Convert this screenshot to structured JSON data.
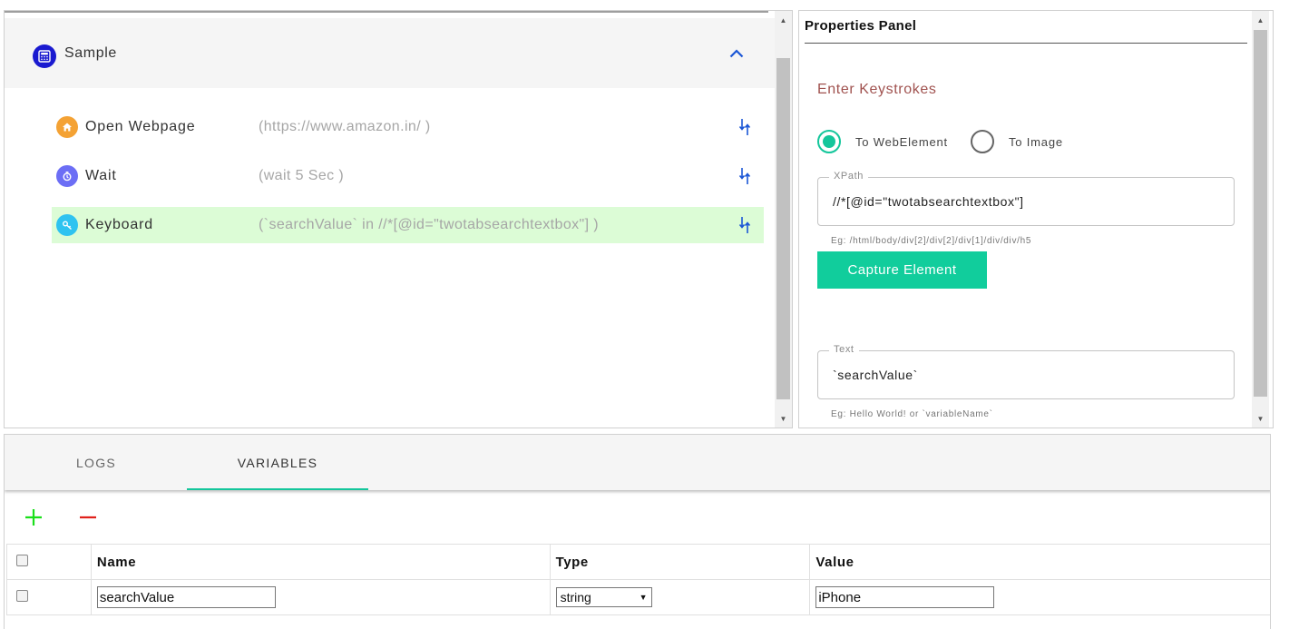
{
  "workflow": {
    "title": "Sample",
    "steps": [
      {
        "name": "Open Webpage",
        "detail": "(https://www.amazon.in/ )",
        "icon": "home-icon",
        "icon_color": "#f4a234",
        "active": false
      },
      {
        "name": "Wait",
        "detail": "(wait 5 Sec )",
        "icon": "timer-icon",
        "icon_color": "#6c6ef5",
        "active": false
      },
      {
        "name": "Keyboard",
        "detail": "(`searchValue` in //*[@id=\"twotabsearchtextbox\"] )",
        "icon": "key-icon",
        "icon_color": "#2fc3f0",
        "active": true
      }
    ]
  },
  "properties": {
    "title": "Properties Panel",
    "section": "Enter Keystrokes",
    "target_options": [
      {
        "label": "To WebElement",
        "checked": true
      },
      {
        "label": "To Image",
        "checked": false
      }
    ],
    "xpath": {
      "label": "XPath",
      "value": "//*[@id=\"twotabsearchtextbox\"]",
      "helper": "Eg: /html/body/div[2]/div[2]/div[1]/div/div/h5"
    },
    "capture_button": "Capture Element",
    "text": {
      "label": "Text",
      "value": "`searchValue`",
      "helper": "Eg: Hello World! or `variableName`"
    }
  },
  "bottom": {
    "tabs": [
      {
        "label": "LOGS",
        "active": false
      },
      {
        "label": "VARIABLES",
        "active": true
      }
    ],
    "table": {
      "headers": [
        "Name",
        "Type",
        "Value"
      ],
      "rows": [
        {
          "name": "searchValue",
          "type": "string",
          "value": "iPhone"
        }
      ]
    }
  },
  "colors": {
    "accent": "#14c69b",
    "active_row": "#dcfcd6",
    "add": "#1adf1a",
    "remove": "#e0211b",
    "section_title": "#a0524f",
    "link_blue": "#1a56d6"
  }
}
